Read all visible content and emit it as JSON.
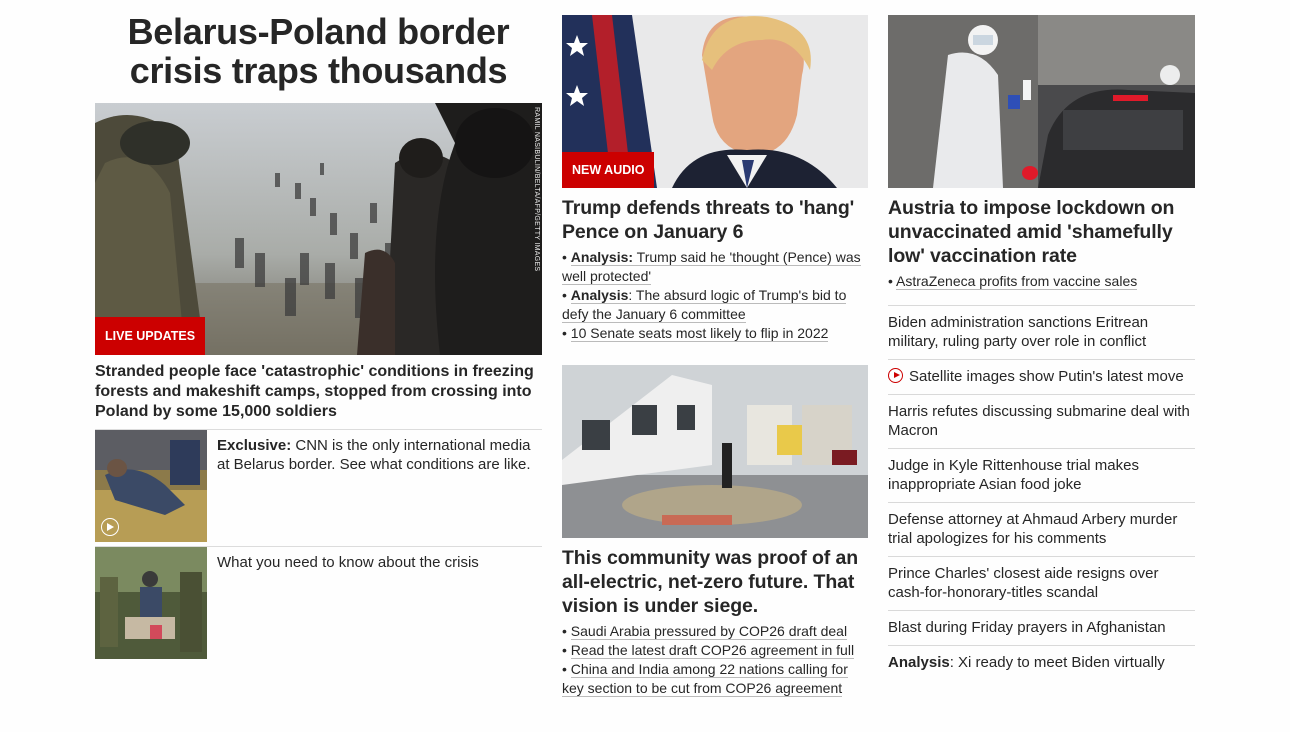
{
  "col1": {
    "title": "Belarus-Poland border crisis traps thousands",
    "hero": {
      "badge": "LIVE UPDATES",
      "credit": "RAMIL NASIBULIN/BELTA/AFP/GETTY IMAGES",
      "description": "Stranded people face 'catastrophic' conditions in freezing forests and makeshift camps, stopped from crossing into Poland by some 15,000 soldiers"
    },
    "items": [
      {
        "bold": "Exclusive:",
        "text": " CNN is the only international media at Belarus border. See what conditions are like.",
        "has_video": true
      },
      {
        "bold": "",
        "text": "What you need to know about the crisis",
        "has_video": false
      }
    ]
  },
  "col2": {
    "story1": {
      "badge": "NEW AUDIO",
      "headline": "Trump defends threats to 'hang' Pence on January 6",
      "bullets": [
        {
          "prefix": "• ",
          "bold": "Analysis:",
          "text": " Trump said he 'thought (Pence) was well protected'"
        },
        {
          "prefix": "• ",
          "bold": "Analysis",
          "text": ": The absurd logic of Trump's bid to defy the January 6 committee"
        },
        {
          "prefix": "• ",
          "bold": "",
          "text": "10 Senate seats most likely to flip in 2022"
        }
      ]
    },
    "story2": {
      "headline": "This community was proof of an all-electric, net-zero future. That vision is under siege.",
      "bullets": [
        {
          "prefix": "• ",
          "text": "Saudi Arabia pressured by COP26 draft deal"
        },
        {
          "prefix": "• ",
          "text": "Read the latest draft COP26 agreement in full"
        },
        {
          "prefix": "• ",
          "text": "China and India among 22 nations calling for key section to be cut from COP26 agreement"
        }
      ]
    }
  },
  "col3": {
    "story": {
      "headline": "Austria to impose lockdown on unvaccinated amid 'shamefully low' vaccination rate",
      "bullet": {
        "prefix": "• ",
        "text": "AstraZeneca profits from vaccine sales"
      }
    },
    "list": [
      {
        "bold": "",
        "text": "Biden administration sanctions Eritrean military, ruling party over role in conflict",
        "video": false
      },
      {
        "bold": "",
        "text": "Satellite images show Putin's latest move",
        "video": true
      },
      {
        "bold": "",
        "text": "Harris refutes discussing submarine deal with Macron",
        "video": false
      },
      {
        "bold": "",
        "text": "Judge in Kyle Rittenhouse trial makes inappropriate Asian food joke",
        "video": false
      },
      {
        "bold": "",
        "text": "Defense attorney at Ahmaud Arbery murder trial apologizes for his comments",
        "video": false
      },
      {
        "bold": "",
        "text": "Prince Charles' closest aide resigns over cash-for-honorary-titles scandal",
        "video": false
      },
      {
        "bold": "",
        "text": "Blast during Friday prayers in Afghanistan",
        "video": false
      },
      {
        "bold": "Analysis",
        "text": ": Xi ready to meet Biden virtually",
        "video": false
      }
    ]
  },
  "colors": {
    "accent": "#cc0000",
    "text": "#262626",
    "divider": "#d9d9d9"
  }
}
